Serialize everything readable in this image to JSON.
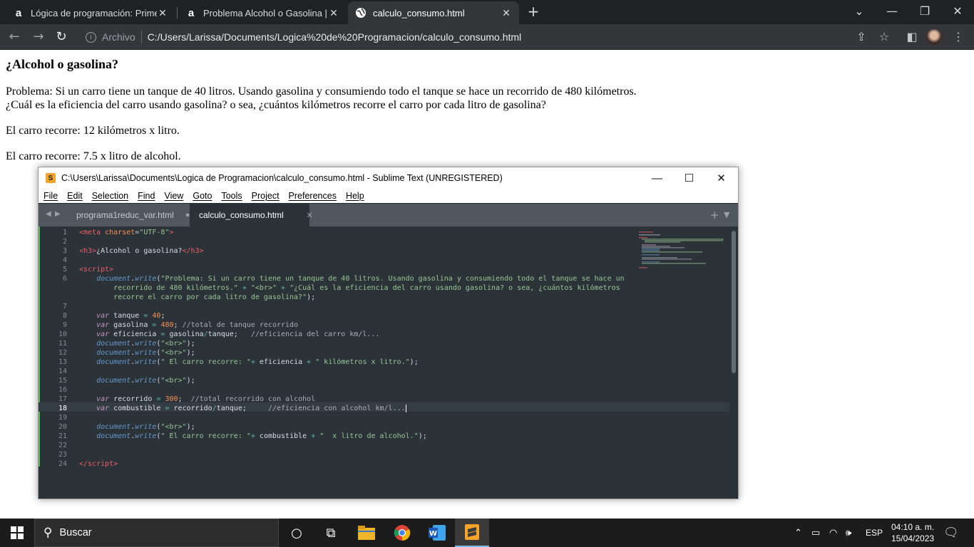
{
  "browser": {
    "tabs": [
      {
        "title": "Lógica de programación: Primeros",
        "favicon": "a"
      },
      {
        "title": "Problema Alcohol o Gasolina | Lóg",
        "favicon": "a"
      },
      {
        "title": "calculo_consumo.html",
        "favicon": "globe"
      }
    ],
    "address_label": "Archivo",
    "url": "C:/Users/Larissa/Documents/Logica%20de%20Programacion/calculo_consumo.html"
  },
  "page": {
    "heading": "¿Alcohol o gasolina?",
    "line1": "Problema: Si un carro tiene un tanque de 40 litros. Usando gasolina y consumiendo todo el tanque se hace un recorrido de 480 kilómetros.",
    "line2": "¿Cuál es la eficiencia del carro usando gasolina? o sea, ¿cuántos kilómetros recorre el carro por cada litro de gasolina?",
    "line3": "El carro recorre: 12 kilómetros x litro.",
    "line4": "El carro recorre: 7.5 x litro de alcohol."
  },
  "sublime": {
    "title": "C:\\Users\\Larissa\\Documents\\Logica de Programacion\\calculo_consumo.html - Sublime Text (UNREGISTERED)",
    "menu": [
      "File",
      "Edit",
      "Selection",
      "Find",
      "View",
      "Goto",
      "Tools",
      "Project",
      "Preferences",
      "Help"
    ],
    "tabs": [
      {
        "label": "programa1reduc_var.html",
        "active": false
      },
      {
        "label": "calculo_consumo.html",
        "active": true
      }
    ],
    "current_line": "18"
  },
  "taskbar": {
    "search_placeholder": "Buscar",
    "language": "ESP",
    "time": "04:10 a. m.",
    "date": "15/04/2023"
  },
  "colors": {
    "chrome_dark": "#202124",
    "sublime_accent": "#f4a32b"
  }
}
